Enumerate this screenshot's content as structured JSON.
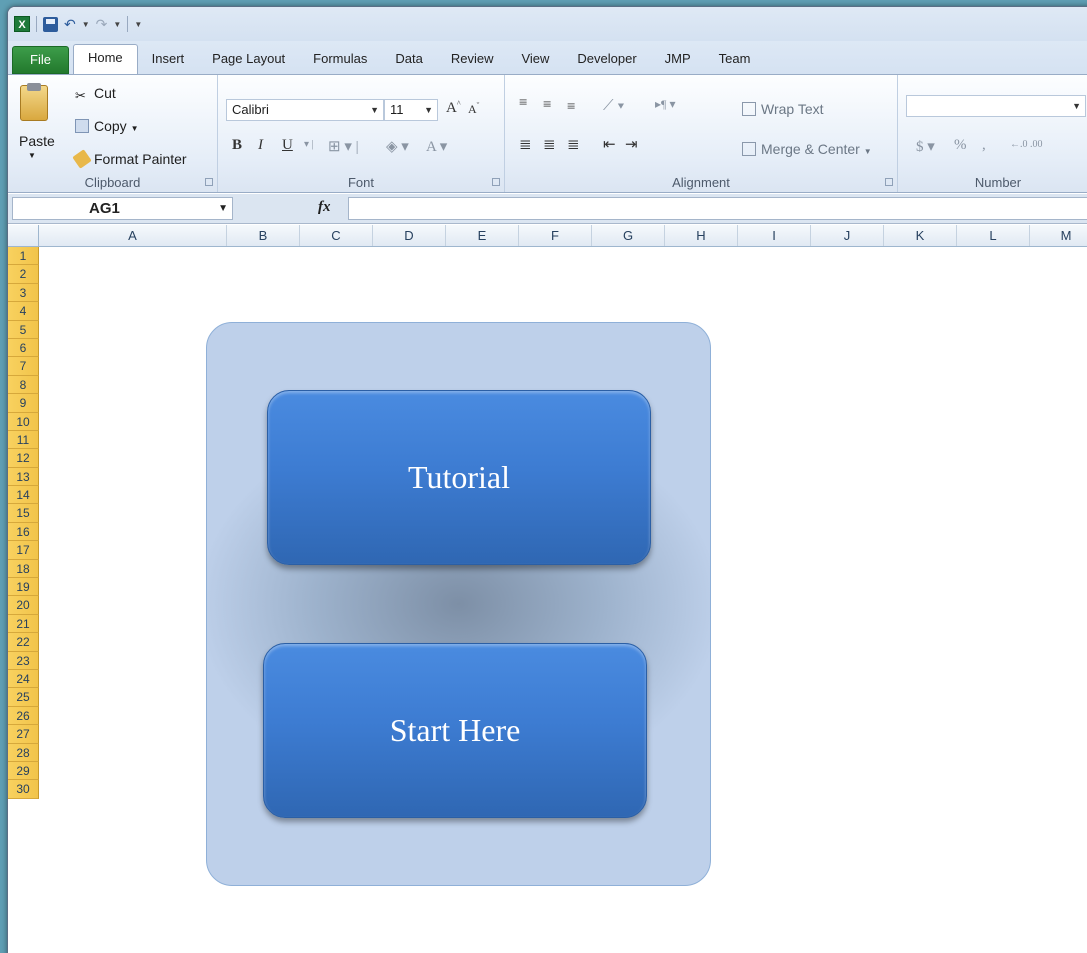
{
  "qat": {
    "separator_glyph": "|"
  },
  "tabs": [
    "File",
    "Home",
    "Insert",
    "Page Layout",
    "Formulas",
    "Data",
    "Review",
    "View",
    "Developer",
    "JMP",
    "Team"
  ],
  "ribbon": {
    "clipboard": {
      "paste": "Paste",
      "cut": "Cut",
      "copy": "Copy",
      "format_painter": "Format Painter",
      "label": "Clipboard"
    },
    "font": {
      "name": "Calibri",
      "size": "11",
      "label": "Font"
    },
    "alignment": {
      "wrap_text": "Wrap Text",
      "merge_center": "Merge & Center",
      "label": "Alignment"
    },
    "number": {
      "format": "",
      "currency": "$",
      "percent": "%",
      "comma": ",",
      "label": "Number"
    }
  },
  "formula_bar": {
    "name_box": "AG1",
    "fx": "fx",
    "content": ""
  },
  "columns": [
    "A",
    "B",
    "C",
    "D",
    "E",
    "F",
    "G",
    "H",
    "I",
    "J",
    "K",
    "L",
    "M"
  ],
  "rows": [
    "1",
    "2",
    "3",
    "4",
    "5",
    "6",
    "7",
    "8",
    "9",
    "10",
    "11",
    "12",
    "13",
    "14",
    "15",
    "16",
    "17",
    "18",
    "19",
    "20",
    "21",
    "22",
    "23",
    "24",
    "25",
    "26",
    "27",
    "28",
    "29",
    "30"
  ],
  "shapes": {
    "tutorial": "Tutorial",
    "start": "Start Here"
  }
}
